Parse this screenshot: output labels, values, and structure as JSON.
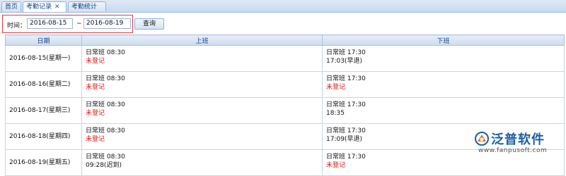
{
  "tabs": [
    {
      "label": "首页",
      "closable": false,
      "active": false
    },
    {
      "label": "考勤记录",
      "closable": true,
      "active": true
    },
    {
      "label": "考勤统计",
      "closable": true,
      "active": false
    }
  ],
  "search": {
    "time_label": "时间：",
    "start_date": "2016-08-15",
    "separator": "~",
    "end_date": "2016-08-19",
    "query_button": "查询"
  },
  "table": {
    "headers": [
      "日期",
      "上班",
      "下班"
    ],
    "rows": [
      {
        "date": "2016-08-15(星期一)",
        "on_shift": "日常班 08:30",
        "on_status": "未登记",
        "on_status_red": true,
        "off_shift": "日常班 17:30",
        "off_status": "17:03(早退)",
        "off_status_red": false
      },
      {
        "date": "2016-08-16(星期二)",
        "on_shift": "日常班 08:30",
        "on_status": "未登记",
        "on_status_red": true,
        "off_shift": "日常班 17:30",
        "off_status": "未登记",
        "off_status_red": true
      },
      {
        "date": "2016-08-17(星期三)",
        "on_shift": "日常班 08:30",
        "on_status": "未登记",
        "on_status_red": true,
        "off_shift": "日常班 17:30",
        "off_status": "18:35",
        "off_status_red": false
      },
      {
        "date": "2016-08-18(星期四)",
        "on_shift": "日常班 08:30",
        "on_status": "未登记",
        "on_status_red": true,
        "off_shift": "日常班 17:30",
        "off_status": "17:09(早退)",
        "off_status_red": false
      },
      {
        "date": "2016-08-19(星期五)",
        "on_shift": "日常班 08:30",
        "on_status": "09:28(迟到)",
        "on_status_red": false,
        "off_shift": "日常班 17:30",
        "off_status": "未登记",
        "off_status_red": true
      }
    ]
  },
  "watermark": {
    "name": "泛普软件",
    "url": "www.fanpusoft.com"
  },
  "colors": {
    "warning_red": "#e01818",
    "highlight_box": "#d84040",
    "brand_blue": "#1b5fa8"
  }
}
